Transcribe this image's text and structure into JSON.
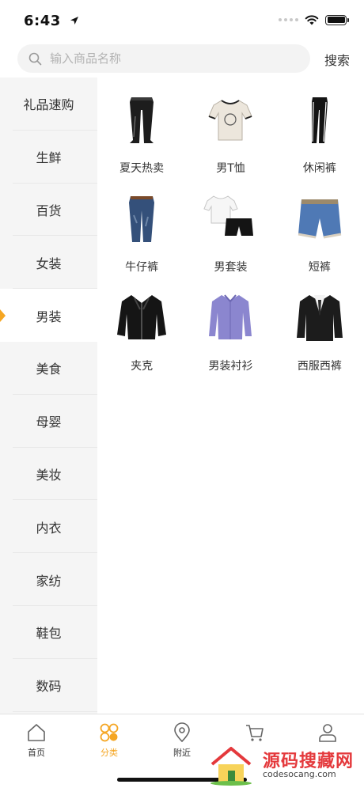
{
  "status_bar": {
    "time": "6:43"
  },
  "search": {
    "placeholder": "输入商品名称",
    "value": "",
    "button_label": "搜索"
  },
  "sidebar": {
    "items": [
      {
        "label": "礼品速购",
        "active": false
      },
      {
        "label": "生鲜",
        "active": false
      },
      {
        "label": "百货",
        "active": false
      },
      {
        "label": "女装",
        "active": false
      },
      {
        "label": "男装",
        "active": true
      },
      {
        "label": "美食",
        "active": false
      },
      {
        "label": "母婴",
        "active": false
      },
      {
        "label": "美妆",
        "active": false
      },
      {
        "label": "内衣",
        "active": false
      },
      {
        "label": "家纺",
        "active": false
      },
      {
        "label": "鞋包",
        "active": false
      },
      {
        "label": "数码",
        "active": false
      }
    ]
  },
  "products": [
    {
      "label": "夏天热卖",
      "icon": "sweatpants-icon"
    },
    {
      "label": "男T恤",
      "icon": "tshirt-icon"
    },
    {
      "label": "休闲裤",
      "icon": "track-pants-icon"
    },
    {
      "label": "牛仔裤",
      "icon": "jeans-icon"
    },
    {
      "label": "男套装",
      "icon": "tshirt-shorts-set-icon"
    },
    {
      "label": "短裤",
      "icon": "denim-shorts-icon"
    },
    {
      "label": "夹克",
      "icon": "leather-jacket-icon"
    },
    {
      "label": "男装衬衫",
      "icon": "dress-shirt-icon"
    },
    {
      "label": "西服西裤",
      "icon": "suit-icon"
    }
  ],
  "tabbar": {
    "items": [
      {
        "label": "首页",
        "icon": "home-icon",
        "active": false
      },
      {
        "label": "分类",
        "icon": "category-icon",
        "active": true
      },
      {
        "label": "附近",
        "icon": "location-icon",
        "active": false
      },
      {
        "label": "",
        "icon": "cart-icon",
        "active": false
      },
      {
        "label": "",
        "icon": "user-icon",
        "active": false
      }
    ]
  },
  "watermark": {
    "title": "源码搜藏网",
    "url": "codesocang.com"
  },
  "colors": {
    "accent": "#f5a623",
    "sidebar_bg": "#f5f5f5",
    "text": "#333333"
  }
}
